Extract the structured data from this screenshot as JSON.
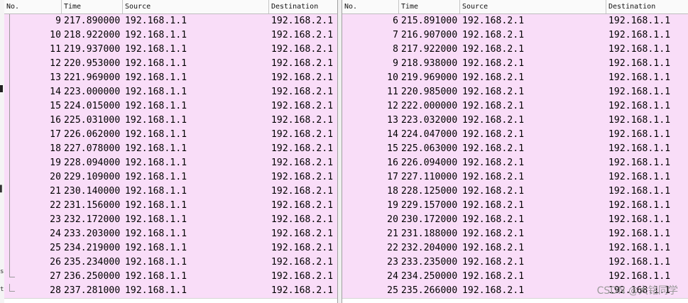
{
  "left_pane": {
    "columns": [
      "No.",
      "Time",
      "Source",
      "Destination"
    ],
    "rows": [
      {
        "no": "9",
        "time": "217.890000",
        "src": "192.168.1.1",
        "dst": "192.168.2.1"
      },
      {
        "no": "10",
        "time": "218.922000",
        "src": "192.168.1.1",
        "dst": "192.168.2.1"
      },
      {
        "no": "11",
        "time": "219.937000",
        "src": "192.168.1.1",
        "dst": "192.168.2.1"
      },
      {
        "no": "12",
        "time": "220.953000",
        "src": "192.168.1.1",
        "dst": "192.168.2.1"
      },
      {
        "no": "13",
        "time": "221.969000",
        "src": "192.168.1.1",
        "dst": "192.168.2.1"
      },
      {
        "no": "14",
        "time": "223.000000",
        "src": "192.168.1.1",
        "dst": "192.168.2.1"
      },
      {
        "no": "15",
        "time": "224.015000",
        "src": "192.168.1.1",
        "dst": "192.168.2.1"
      },
      {
        "no": "16",
        "time": "225.031000",
        "src": "192.168.1.1",
        "dst": "192.168.2.1"
      },
      {
        "no": "17",
        "time": "226.062000",
        "src": "192.168.1.1",
        "dst": "192.168.2.1"
      },
      {
        "no": "18",
        "time": "227.078000",
        "src": "192.168.1.1",
        "dst": "192.168.2.1"
      },
      {
        "no": "19",
        "time": "228.094000",
        "src": "192.168.1.1",
        "dst": "192.168.2.1"
      },
      {
        "no": "20",
        "time": "229.109000",
        "src": "192.168.1.1",
        "dst": "192.168.2.1"
      },
      {
        "no": "21",
        "time": "230.140000",
        "src": "192.168.1.1",
        "dst": "192.168.2.1"
      },
      {
        "no": "22",
        "time": "231.156000",
        "src": "192.168.1.1",
        "dst": "192.168.2.1"
      },
      {
        "no": "23",
        "time": "232.172000",
        "src": "192.168.1.1",
        "dst": "192.168.2.1"
      },
      {
        "no": "24",
        "time": "233.203000",
        "src": "192.168.1.1",
        "dst": "192.168.2.1"
      },
      {
        "no": "25",
        "time": "234.219000",
        "src": "192.168.1.1",
        "dst": "192.168.2.1"
      },
      {
        "no": "26",
        "time": "235.234000",
        "src": "192.168.1.1",
        "dst": "192.168.2.1"
      },
      {
        "no": "27",
        "time": "236.250000",
        "src": "192.168.1.1",
        "dst": "192.168.2.1"
      },
      {
        "no": "28",
        "time": "237.281000",
        "src": "192.168.1.1",
        "dst": "192.168.2.1"
      }
    ]
  },
  "right_pane": {
    "columns": [
      "No.",
      "Time",
      "Source",
      "Destination"
    ],
    "rows": [
      {
        "no": "6",
        "time": "215.891000",
        "src": "192.168.2.1",
        "dst": "192.168.1.1"
      },
      {
        "no": "7",
        "time": "216.907000",
        "src": "192.168.2.1",
        "dst": "192.168.1.1"
      },
      {
        "no": "8",
        "time": "217.922000",
        "src": "192.168.2.1",
        "dst": "192.168.1.1"
      },
      {
        "no": "9",
        "time": "218.938000",
        "src": "192.168.2.1",
        "dst": "192.168.1.1"
      },
      {
        "no": "10",
        "time": "219.969000",
        "src": "192.168.2.1",
        "dst": "192.168.1.1"
      },
      {
        "no": "11",
        "time": "220.985000",
        "src": "192.168.2.1",
        "dst": "192.168.1.1"
      },
      {
        "no": "12",
        "time": "222.000000",
        "src": "192.168.2.1",
        "dst": "192.168.1.1"
      },
      {
        "no": "13",
        "time": "223.032000",
        "src": "192.168.2.1",
        "dst": "192.168.1.1"
      },
      {
        "no": "14",
        "time": "224.047000",
        "src": "192.168.2.1",
        "dst": "192.168.1.1"
      },
      {
        "no": "15",
        "time": "225.063000",
        "src": "192.168.2.1",
        "dst": "192.168.1.1"
      },
      {
        "no": "16",
        "time": "226.094000",
        "src": "192.168.2.1",
        "dst": "192.168.1.1"
      },
      {
        "no": "17",
        "time": "227.110000",
        "src": "192.168.2.1",
        "dst": "192.168.1.1"
      },
      {
        "no": "18",
        "time": "228.125000",
        "src": "192.168.2.1",
        "dst": "192.168.1.1"
      },
      {
        "no": "19",
        "time": "229.157000",
        "src": "192.168.2.1",
        "dst": "192.168.1.1"
      },
      {
        "no": "20",
        "time": "230.172000",
        "src": "192.168.2.1",
        "dst": "192.168.1.1"
      },
      {
        "no": "21",
        "time": "231.188000",
        "src": "192.168.2.1",
        "dst": "192.168.1.1"
      },
      {
        "no": "22",
        "time": "232.204000",
        "src": "192.168.2.1",
        "dst": "192.168.1.1"
      },
      {
        "no": "23",
        "time": "233.235000",
        "src": "192.168.2.1",
        "dst": "192.168.1.1"
      },
      {
        "no": "24",
        "time": "234.250000",
        "src": "192.168.2.1",
        "dst": "192.168.1.1"
      },
      {
        "no": "25",
        "time": "235.266000",
        "src": "192.168.2.1",
        "dst": "192.168.1.1"
      }
    ]
  },
  "watermark": "CSDN @大铭同学",
  "colors": {
    "row_bg": "#f9ddf8",
    "header_bg": "#fafafa"
  }
}
